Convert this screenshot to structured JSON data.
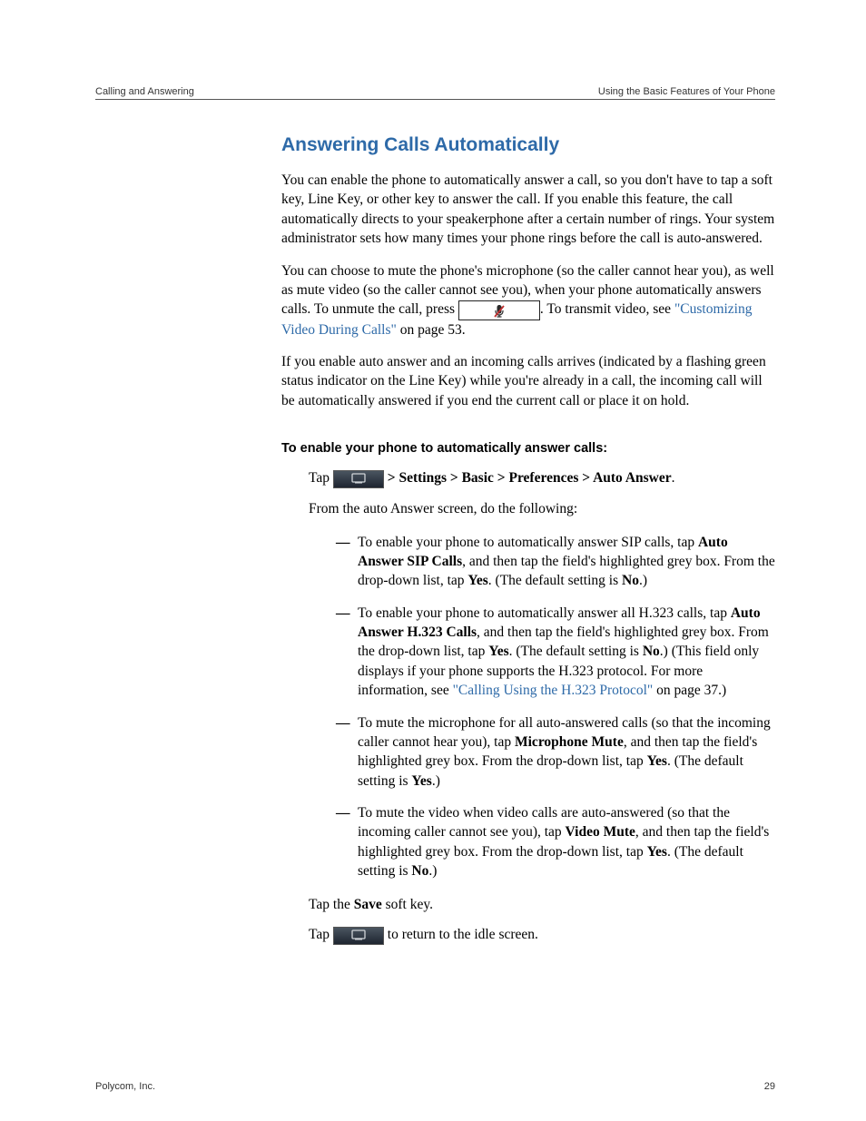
{
  "header": {
    "left": "Calling and Answering",
    "right": "Using the Basic Features of Your Phone"
  },
  "section_title": "Answering Calls Automatically",
  "p1": "You can enable the phone to automatically answer a call, so you don't have to tap a soft key, Line Key, or other key to answer the call. If you enable this feature, the call automatically directs to your speakerphone after a certain number of rings. Your system administrator sets how many times your phone rings before the call is auto-answered.",
  "p2_a": "You can choose to mute the phone's microphone (so the caller cannot hear you), as well as mute video (so the caller cannot see you), when your phone automatically answers calls. To unmute the call, press ",
  "p2_b": ". To transmit video, see ",
  "p2_link": "\"Customizing Video During Calls\"",
  "p2_c": " on page 53.",
  "p3": "If you enable auto answer and an incoming calls arrives (indicated by a flashing green status indicator on the Line Key) while you're already in a call, the incoming call will be automatically answered if you end the current call or place it on hold.",
  "task_heading": "To enable your phone to automatically answer calls:",
  "step1_a": "Tap ",
  "step1_b": " > Settings > Basic > Preferences > Auto Answer",
  "step1_c": ".",
  "step2": "From the auto Answer screen, do the following:",
  "bullets": {
    "b1_a": "To enable your phone to automatically answer SIP calls, tap ",
    "b1_bold": "Auto Answer SIP Calls",
    "b1_b": ", and then tap the field's highlighted grey box. From the drop-down list, tap ",
    "b1_yes": "Yes",
    "b1_c": ". (The default setting is ",
    "b1_no": "No",
    "b1_d": ".)",
    "b2_a": "To enable your phone to automatically answer all H.323 calls, tap ",
    "b2_bold": "Auto Answer H.323 Calls",
    "b2_b": ", and then tap the field's highlighted grey box. From the drop-down list, tap ",
    "b2_yes": "Yes",
    "b2_c": ". (The default setting is ",
    "b2_no": "No",
    "b2_d": ".) (This field only displays if your phone supports the H.323 protocol. For more information, see ",
    "b2_link": "\"Calling Using the H.323 Protocol\"",
    "b2_e": " on page 37.)",
    "b3_a": "To mute the microphone for all auto-answered calls (so that the incoming caller cannot hear you), tap ",
    "b3_bold": "Microphone Mute",
    "b3_b": ", and then tap the field's highlighted grey box. From the drop-down list, tap ",
    "b3_yes": "Yes",
    "b3_c": ". (The default setting is ",
    "b3_yes2": "Yes",
    "b3_d": ".)",
    "b4_a": "To mute the video when video calls are auto-answered (so that the incoming caller cannot see you), tap ",
    "b4_bold": "Video Mute",
    "b4_b": ", and then tap the field's highlighted grey box. From the drop-down list, tap ",
    "b4_yes": "Yes",
    "b4_c": ". (The default setting is ",
    "b4_no": "No",
    "b4_d": ".)"
  },
  "step3_a": "Tap the ",
  "step3_bold": "Save",
  "step3_b": " soft key.",
  "step4_a": "Tap ",
  "step4_b": " to return to the idle screen.",
  "footer": {
    "left": "Polycom, Inc.",
    "right": "29"
  }
}
